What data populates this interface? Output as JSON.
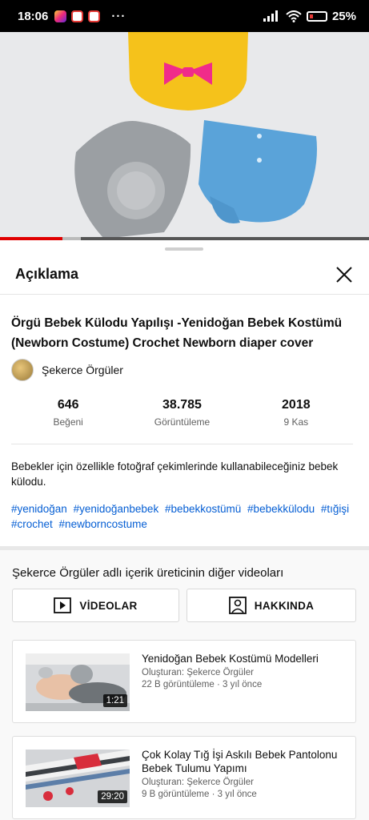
{
  "status_bar": {
    "time": "18:06",
    "overflow": "···",
    "battery": "25",
    "battery_level": 0.25
  },
  "player": {
    "progress": 0.17,
    "buffered": 0.05
  },
  "sheet": {
    "title": "Açıklama"
  },
  "video": {
    "title": "Örgü Bebek Külodu Yapılışı -Yenidoğan Bebek Kostümü (Newborn Costume) Crochet Newborn diaper cover",
    "channel": "Şekerce Örgüler",
    "stats": [
      {
        "value": "646",
        "label": "Beğeni"
      },
      {
        "value": "38.785",
        "label": "Görüntüleme"
      },
      {
        "value": "2018",
        "label": "9 Kas"
      }
    ],
    "description": "Bebekler için özellikle fotoğraf çekimlerinde kullanabileceğiniz bebek külodu.",
    "hashtags": [
      "#yenidoğan",
      "#yenidoğanbebek",
      "#bebekkostümü",
      "#bebekkülodu",
      "#tığişi",
      "#crochet",
      "#newborncostume"
    ]
  },
  "other_videos": {
    "heading": "Şekerce Örgüler adlı içerik üreticinin diğer videoları",
    "videos_button": "VİDEOLAR",
    "about_button": "HAKKINDA",
    "items": [
      {
        "title": "Yenidoğan Bebek Kostümü Modelleri",
        "author": "Oluşturan: Şekerce Örgüler",
        "meta": "22 B görüntüleme · 3 yıl önce",
        "duration": "1:21"
      },
      {
        "title": "Çok Kolay Tığ İşi Askılı Bebek Pantolonu Bebek Tulumu Yapımı",
        "author": "Oluşturan: Şekerce Örgüler",
        "meta": "9 B görüntüleme · 3 yıl önce",
        "duration": "29:20"
      }
    ]
  },
  "colors": {
    "accent_red": "#e00000",
    "link_blue": "#065fd4"
  }
}
